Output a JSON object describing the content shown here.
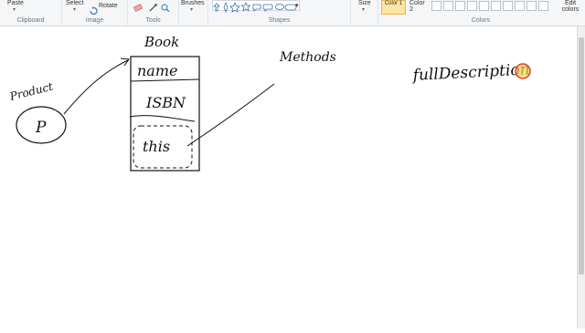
{
  "ribbon": {
    "clipboard": {
      "paste_label": "Paste",
      "group_label": "Clipboard"
    },
    "image": {
      "select_label": "Select",
      "rotate_label": "Rotate",
      "group_label": "Image"
    },
    "tools": {
      "group_label": "Tools"
    },
    "brushes": {
      "label": "Brushes"
    },
    "shapes": {
      "group_label": "Shapes"
    },
    "size": {
      "label": "Size"
    },
    "colors": {
      "color1_label": "Color 1",
      "color2_label": "Color 2",
      "group_label": "Colors",
      "edit_label": "Edit colors"
    }
  },
  "drawing": {
    "product_label": "Product",
    "p_label": "P",
    "book_label": "Book",
    "field_name": "name",
    "field_isbn": "ISBN",
    "field_this": "this",
    "methods_label": "Methods",
    "method_text": "fullDescription"
  },
  "colors": {
    "ribbon_bg": "#f5f6f7",
    "highlight": "#e23a3a",
    "ink": "#111111"
  }
}
